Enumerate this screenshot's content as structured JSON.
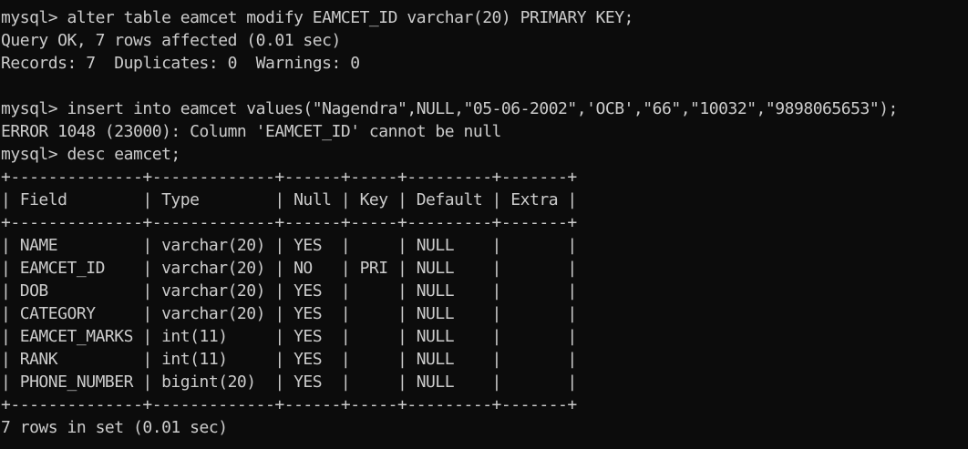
{
  "terminal": {
    "lines": [
      "mysql> alter table eamcet modify EAMCET_ID varchar(20) PRIMARY KEY;",
      "Query OK, 7 rows affected (0.01 sec)",
      "Records: 7  Duplicates: 0  Warnings: 0",
      "",
      "mysql> insert into eamcet values(\"Nagendra\",NULL,\"05-06-2002\",'OCB',\"66\",\"10032\",\"9898065653\");",
      "ERROR 1048 (23000): Column 'EAMCET_ID' cannot be null",
      "mysql> desc eamcet;",
      "+--------------+-------------+------+-----+---------+-------+",
      "| Field        | Type        | Null | Key | Default | Extra |",
      "+--------------+-------------+------+-----+---------+-------+",
      "| NAME         | varchar(20) | YES  |     | NULL    |       |",
      "| EAMCET_ID    | varchar(20) | NO   | PRI | NULL    |       |",
      "| DOB          | varchar(20) | YES  |     | NULL    |       |",
      "| CATEGORY     | varchar(20) | YES  |     | NULL    |       |",
      "| EAMCET_MARKS | int(11)     | YES  |     | NULL    |       |",
      "| RANK         | int(11)     | YES  |     | NULL    |       |",
      "| PHONE_NUMBER | bigint(20)  | YES  |     | NULL    |       |",
      "+--------------+-------------+------+-----+---------+-------+",
      "7 rows in set (0.01 sec)"
    ]
  },
  "colors": {
    "background": "#0c0c0c",
    "text": "#cccccc"
  }
}
